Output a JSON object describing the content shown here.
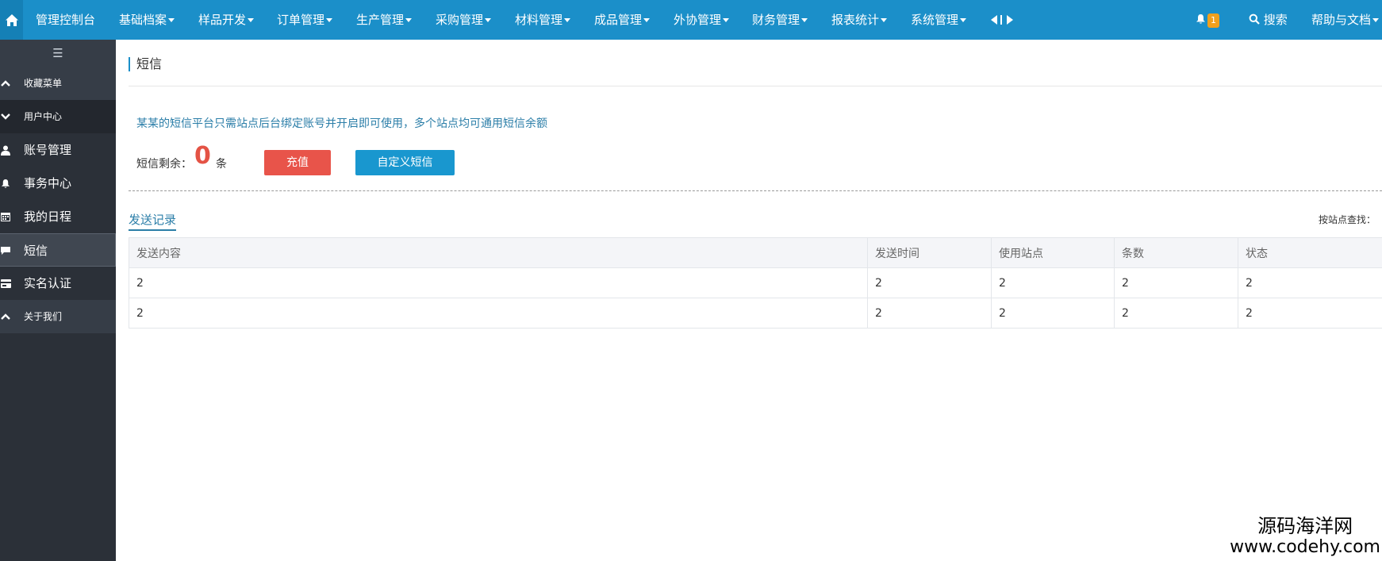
{
  "topbar": {
    "menu": [
      {
        "label": "管理控制台",
        "dropdown": false
      },
      {
        "label": "基础档案",
        "dropdown": true
      },
      {
        "label": "样品开发",
        "dropdown": true
      },
      {
        "label": "订单管理",
        "dropdown": true
      },
      {
        "label": "生产管理",
        "dropdown": true
      },
      {
        "label": "采购管理",
        "dropdown": true
      },
      {
        "label": "材料管理",
        "dropdown": true
      },
      {
        "label": "成品管理",
        "dropdown": true
      },
      {
        "label": "外协管理",
        "dropdown": true
      },
      {
        "label": "财务管理",
        "dropdown": true
      },
      {
        "label": "报表统计",
        "dropdown": true
      },
      {
        "label": "系统管理",
        "dropdown": true
      }
    ],
    "notification_count": "1",
    "search_label": "搜索",
    "help_label": "帮助与文档"
  },
  "sidebar": {
    "toggle": "☰",
    "favorites": "收藏菜单",
    "user_center": "用户中心",
    "items": [
      {
        "label": "账号管理",
        "icon": "user-icon"
      },
      {
        "label": "事务中心",
        "icon": "bell-icon"
      },
      {
        "label": "我的日程",
        "icon": "calendar-icon"
      },
      {
        "label": "短信",
        "icon": "comment-icon"
      },
      {
        "label": "实名认证",
        "icon": "id-card-icon"
      }
    ],
    "about": "关于我们"
  },
  "page": {
    "title": "短信",
    "notice": "某某的短信平台只需站点后台绑定账号并开启即可使用，多个站点均可通用短信余额",
    "remain_label": "短信剩余：",
    "remain_count": "0",
    "remain_unit": "条",
    "recharge_button": "充值",
    "custom_sms_button": "自定义短信",
    "tab_label": "发送记录",
    "site_search_label": "按站点查找："
  },
  "table": {
    "headers": [
      "发送内容",
      "发送时间",
      "使用站点",
      "条数",
      "状态"
    ],
    "rows": [
      [
        "2",
        "2",
        "2",
        "2",
        "2"
      ],
      [
        "2",
        "2",
        "2",
        "2",
        "2"
      ]
    ]
  },
  "watermark": {
    "line1": "源码海洋网",
    "line2": "www.codehy.com"
  },
  "colors": {
    "topbar": "#1b8fc9",
    "sidebar": "#2b3038",
    "accent": "#2b7ea8",
    "danger": "#e8544a",
    "primary": "#1997cf",
    "badge": "#f0a01d"
  }
}
